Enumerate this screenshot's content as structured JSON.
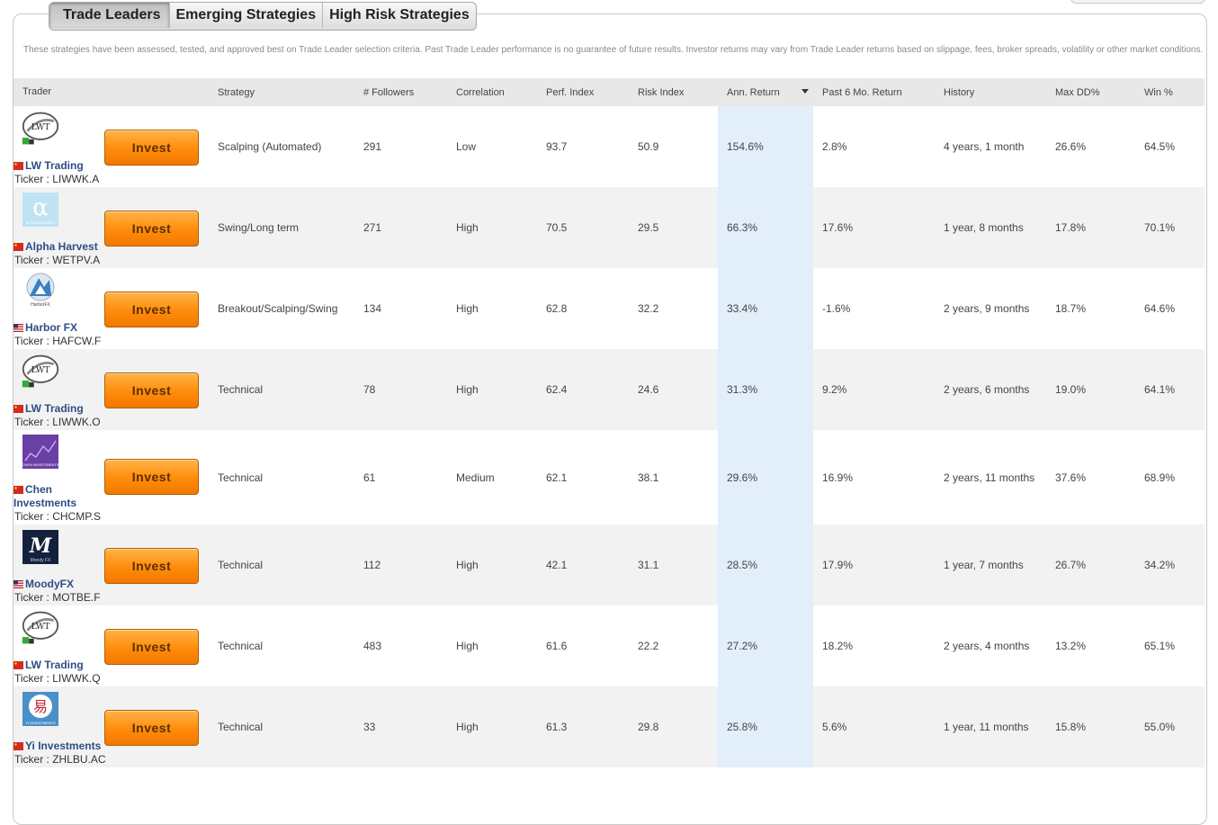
{
  "tabs": [
    {
      "label": "Trade Leaders",
      "active": true
    },
    {
      "label": "Emerging Strategies",
      "active": false
    },
    {
      "label": "High Risk Strategies",
      "active": false
    }
  ],
  "disclaimer": "These strategies have been assessed, tested, and approved best on Trade Leader selection criteria. Past Trade Leader performance is no guarantee of future results. Investor returns may vary from Trade Leader returns based on slippage, fees, broker spreads, volatility or other market conditions.",
  "columns": {
    "trader": "Trader",
    "strategy": "Strategy",
    "followers": "# Followers",
    "correlation": "Correlation",
    "perf": "Perf. Index",
    "risk": "Risk Index",
    "ann_return": "Ann. Return",
    "past6": "Past 6 Mo. Return",
    "history": "History",
    "maxdd": "Max DD%",
    "win": "Win %"
  },
  "invest_label": "Invest",
  "rows": [
    {
      "logo": "lwt-logo",
      "flag": "china-flag",
      "name": "LW Trading",
      "ticker": "Ticker : LIWWK.A",
      "strategy": "Scalping (Automated)",
      "followers": "291",
      "correlation": "Low",
      "perf": "93.7",
      "risk": "50.9",
      "ann_return": "154.6%",
      "past6": "2.8%",
      "history": "4 years, 1 month",
      "maxdd": "26.6%",
      "win": "64.5%"
    },
    {
      "logo": "alpha-harvest-logo",
      "flag": "china-flag",
      "name": "Alpha Harvest",
      "ticker": "Ticker : WETPV.A",
      "strategy": "Swing/Long term",
      "followers": "271",
      "correlation": "High",
      "perf": "70.5",
      "risk": "29.5",
      "ann_return": "66.3%",
      "past6": "17.6%",
      "history": "1 year, 8 months",
      "maxdd": "17.8%",
      "win": "70.1%"
    },
    {
      "logo": "harbor-fx-logo",
      "flag": "us-flag",
      "name": "Harbor FX",
      "ticker": "Ticker : HAFCW.F",
      "strategy": "Breakout/Scalping/Swing",
      "followers": "134",
      "correlation": "High",
      "perf": "62.8",
      "risk": "32.2",
      "ann_return": "33.4%",
      "past6": "-1.6%",
      "history": "2 years, 9 months",
      "maxdd": "18.7%",
      "win": "64.6%"
    },
    {
      "logo": "lwt-logo",
      "flag": "china-flag",
      "name": "LW Trading",
      "ticker": "Ticker : LIWWK.O",
      "strategy": "Technical",
      "followers": "78",
      "correlation": "High",
      "perf": "62.4",
      "risk": "24.6",
      "ann_return": "31.3%",
      "past6": "9.2%",
      "history": "2 years, 6 months",
      "maxdd": "19.0%",
      "win": "64.1%"
    },
    {
      "logo": "chen-logo",
      "flag": "china-flag",
      "name": "Chen Investments",
      "ticker": "Ticker : CHCMP.S",
      "strategy": "Technical",
      "followers": "61",
      "correlation": "Medium",
      "perf": "62.1",
      "risk": "38.1",
      "ann_return": "29.6%",
      "past6": "16.9%",
      "history": "2 years, 11 months",
      "maxdd": "37.6%",
      "win": "68.9%"
    },
    {
      "logo": "moody-fx-logo",
      "flag": "us-flag",
      "name": "MoodyFX",
      "ticker": "Ticker : MOTBE.F",
      "strategy": "Technical",
      "followers": "112",
      "correlation": "High",
      "perf": "42.1",
      "risk": "31.1",
      "ann_return": "28.5%",
      "past6": "17.9%",
      "history": "1 year, 7 months",
      "maxdd": "26.7%",
      "win": "34.2%"
    },
    {
      "logo": "lwt-logo",
      "flag": "china-flag",
      "name": "LW Trading",
      "ticker": "Ticker : LIWWK.Q",
      "strategy": "Technical",
      "followers": "483",
      "correlation": "High",
      "perf": "61.6",
      "risk": "22.2",
      "ann_return": "27.2%",
      "past6": "18.2%",
      "history": "2 years, 4 months",
      "maxdd": "13.2%",
      "win": "65.1%"
    },
    {
      "logo": "yi-logo",
      "flag": "china-flag",
      "name": "Yi Investments",
      "ticker": "Ticker : ZHLBU.AC",
      "strategy": "Technical",
      "followers": "33",
      "correlation": "High",
      "perf": "61.3",
      "risk": "29.8",
      "ann_return": "25.8%",
      "past6": "5.6%",
      "history": "1 year, 11 months",
      "maxdd": "15.8%",
      "win": "55.0%"
    }
  ],
  "logo_text": {
    "lwt": "LWT",
    "alpha_sub": "ALPHA HARVEST",
    "harbor": "HarborFX",
    "chen": "CHEN INVESTMENTS",
    "moody_letter": "M",
    "moody_sub": "Moody FX",
    "yi_char": "易",
    "yi_sub": "YI INVESTMENTS"
  },
  "colors": {
    "invest_button": "#ff8c0a",
    "sorted_column": "#e3eefb",
    "trader_name": "#2d4e84"
  }
}
